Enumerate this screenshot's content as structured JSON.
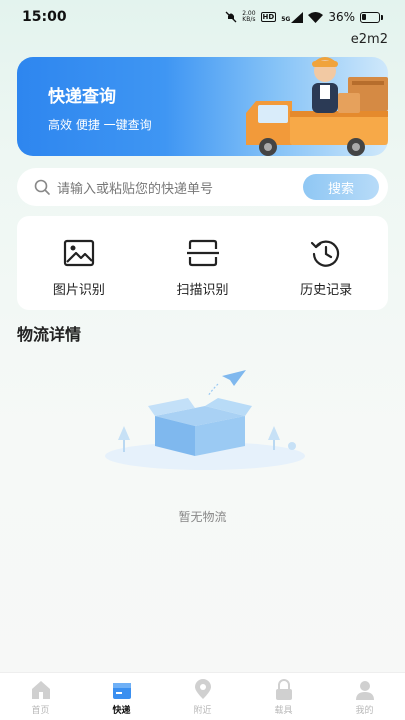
{
  "status_bar": {
    "time": "15:00",
    "net_speed_value": "2.00",
    "net_speed_unit": "KB/s",
    "hd_label": "HD",
    "network_label": "5G",
    "battery": "36%"
  },
  "user": {
    "name": "e2m2"
  },
  "banner": {
    "title": "快递查询",
    "subtitle": "高效 便捷 一键查询"
  },
  "search": {
    "placeholder": "请输入或粘贴您的快递单号",
    "button_label": "搜索"
  },
  "tools": [
    {
      "label": "图片识别",
      "icon": "image-icon"
    },
    {
      "label": "扫描识别",
      "icon": "scan-icon"
    },
    {
      "label": "历史记录",
      "icon": "history-icon"
    }
  ],
  "logistics": {
    "title": "物流详情",
    "empty_text": "暂无物流"
  },
  "tabbar": {
    "items": [
      {
        "label": "首页",
        "icon": "home-icon",
        "active": false
      },
      {
        "label": "快递",
        "icon": "package-icon",
        "active": true
      },
      {
        "label": "附近",
        "icon": "location-icon",
        "active": false
      },
      {
        "label": "载具",
        "icon": "lock-icon",
        "active": false
      },
      {
        "label": "我的",
        "icon": "profile-icon",
        "active": false
      }
    ]
  },
  "colors": {
    "accent": "#2e86ef",
    "search_button": "#8fc7f4",
    "inactive_tab": "#b8b8b8"
  }
}
